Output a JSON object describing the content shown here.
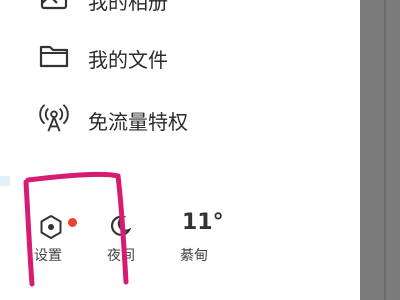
{
  "menu": {
    "items": [
      {
        "label": "我的相册",
        "icon": "album-icon"
      },
      {
        "label": "我的文件",
        "icon": "folder-icon"
      },
      {
        "label": "免流量特权",
        "icon": "antenna-icon"
      }
    ]
  },
  "bottom_bar": {
    "settings_label": "设置",
    "settings_badge_color": "#e8452c",
    "night_label": "夜间",
    "temperature": "11°",
    "city": "綦甸"
  },
  "colors": {
    "annotation": "#d81b72",
    "scrim": "#7b7b7b",
    "text": "#2b2b2b",
    "icon": "#333333"
  }
}
